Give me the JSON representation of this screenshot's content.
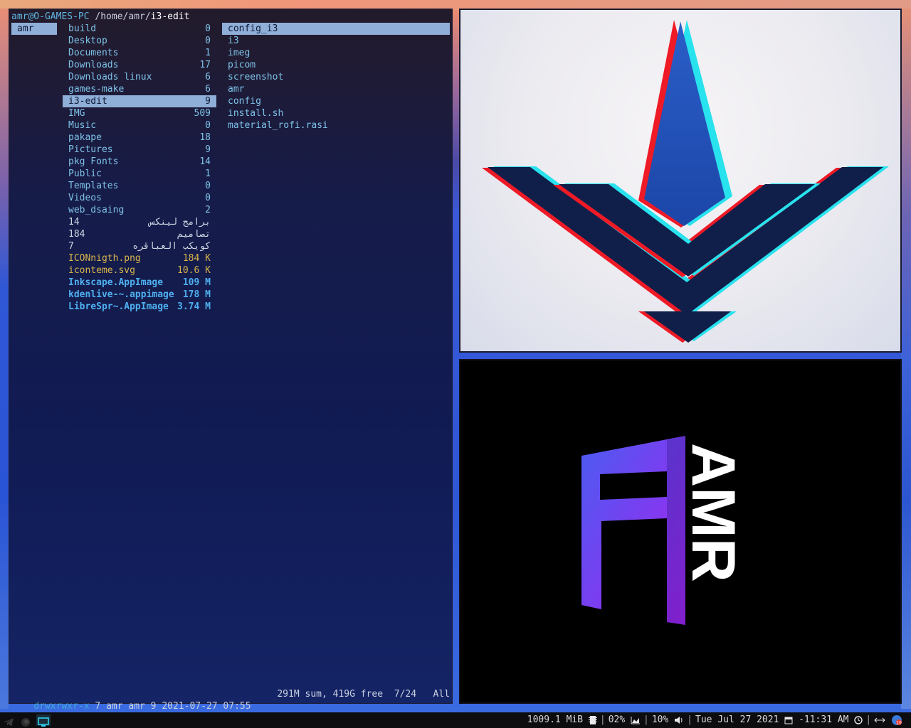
{
  "terminal": {
    "host": "amr@O-GAMES-PC",
    "path_prefix": " /home/amr/",
    "path_current": "i3-edit",
    "parent_col": [
      {
        "name": "amr",
        "selected": true
      }
    ],
    "current_col": [
      {
        "name": "build",
        "count": "0",
        "kind": "dir"
      },
      {
        "name": "Desktop",
        "count": "0",
        "kind": "dir"
      },
      {
        "name": "Documents",
        "count": "1",
        "kind": "dir"
      },
      {
        "name": "Downloads",
        "count": "17",
        "kind": "dir"
      },
      {
        "name": "Downloads linux",
        "count": "6",
        "kind": "dir"
      },
      {
        "name": "games-make",
        "count": "6",
        "kind": "dir"
      },
      {
        "name": "i3-edit",
        "count": "9",
        "kind": "dir",
        "selected": true
      },
      {
        "name": "IMG",
        "count": "509",
        "kind": "dir"
      },
      {
        "name": "Music",
        "count": "0",
        "kind": "dir"
      },
      {
        "name": "pakape",
        "count": "18",
        "kind": "dir"
      },
      {
        "name": "Pictures",
        "count": "9",
        "kind": "dir"
      },
      {
        "name": "pkg Fonts",
        "count": "14",
        "kind": "dir"
      },
      {
        "name": "Public",
        "count": "1",
        "kind": "dir"
      },
      {
        "name": "Templates",
        "count": "0",
        "kind": "dir"
      },
      {
        "name": "Videos",
        "count": "0",
        "kind": "dir"
      },
      {
        "name": "web_dsaing",
        "count": "2",
        "kind": "dir"
      },
      {
        "name": "برامج لينكس",
        "count": "14",
        "kind": "rtl"
      },
      {
        "name": "تصاميم",
        "count": "184",
        "kind": "rtl"
      },
      {
        "name": "كويكب العباقره",
        "count": "7",
        "kind": "rtl"
      },
      {
        "name": "ICONnigth.png",
        "count": "184 K",
        "kind": "img"
      },
      {
        "name": "iconteme.svg",
        "count": "10.6 K",
        "kind": "img"
      },
      {
        "name": "Inkscape.AppImage",
        "count": "109 M",
        "kind": "exe"
      },
      {
        "name": "kdenlive-~.appimage",
        "count": "178 M",
        "kind": "exe"
      },
      {
        "name": "LibreSpr~.AppImage",
        "count": "3.74 M",
        "kind": "exe"
      }
    ],
    "preview_col": [
      {
        "name": "config_i3",
        "selected": true
      },
      {
        "name": "i3"
      },
      {
        "name": "imeg"
      },
      {
        "name": "picom"
      },
      {
        "name": "screenshot"
      },
      {
        "name": "amr"
      },
      {
        "name": "config"
      },
      {
        "name": "install.sh"
      },
      {
        "name": "material_rofi.rasi"
      }
    ],
    "status": {
      "perm": "drwxrwxr-x",
      "info": " 7 amr amr 9 2021-07-27 07:55",
      "right": "291M sum, 419G free  7/24   All"
    }
  },
  "viewer_bottom": {
    "logo_text": "AMR"
  },
  "taskbar": {
    "memory": "1009.1 MiB",
    "cpu": "02%",
    "volume": "10%",
    "date": "Tue Jul 27 2021",
    "time": "-11:31 AM",
    "badge": "10"
  },
  "colors": {
    "selection": "#8faed8",
    "dir": "#7fc3e8",
    "image_file": "#d9b64a",
    "executable": "#4fb0f0",
    "host": "#5fb6e0"
  }
}
